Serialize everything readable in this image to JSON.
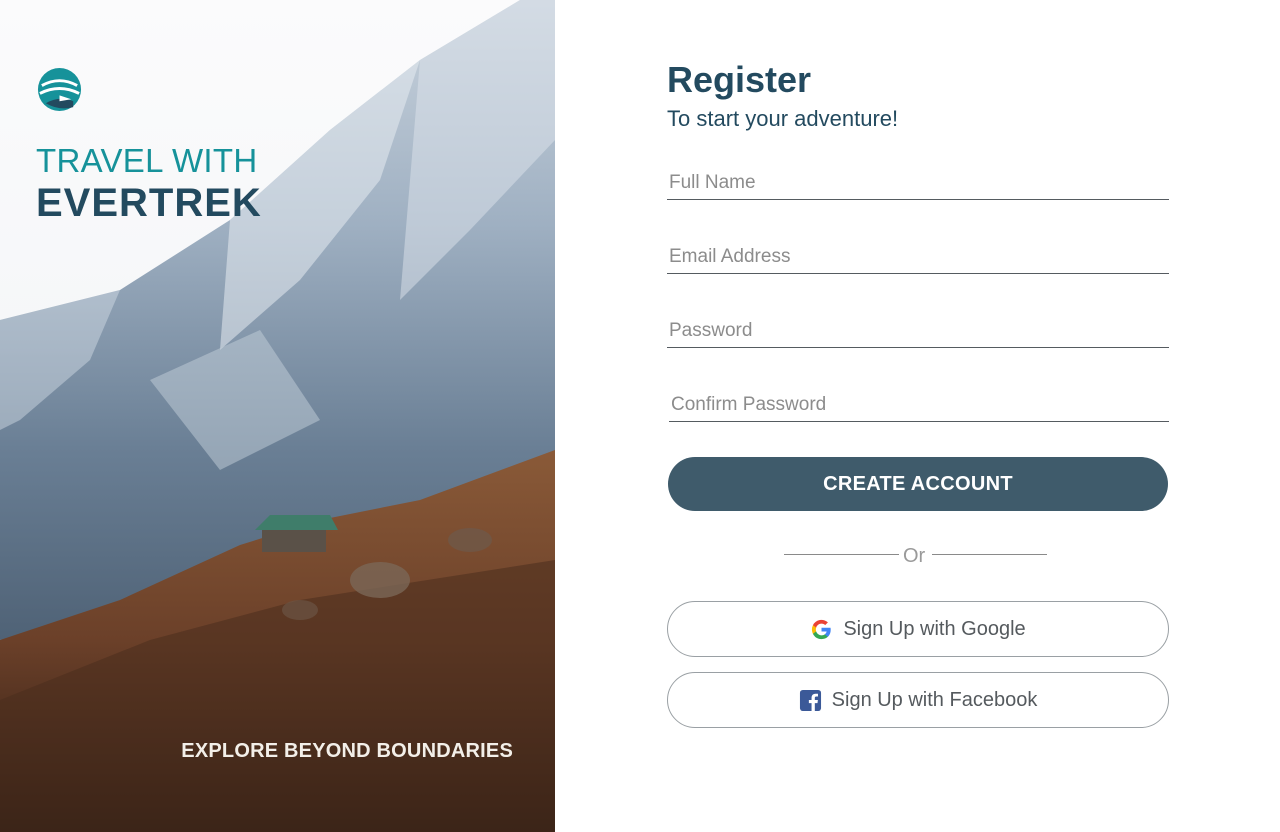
{
  "brand": {
    "line1": "TRAVEL WITH",
    "line2": "EVERTREK",
    "tagline": "EXPLORE BEYOND BOUNDARIES",
    "logo_icon": "globe-airplane-icon"
  },
  "form": {
    "title": "Register",
    "subtitle": "To start your adventure!",
    "fields": {
      "full_name": {
        "placeholder": "Full Name",
        "value": ""
      },
      "email": {
        "placeholder": "Email Address",
        "value": ""
      },
      "password": {
        "placeholder": "Password",
        "value": ""
      },
      "confirm_password": {
        "placeholder": "Confirm Password",
        "value": ""
      }
    },
    "create_label": "CREATE ACCOUNT",
    "divider_label": "Or",
    "google_label": "Sign Up with Google",
    "facebook_label": "Sign Up with Facebook"
  },
  "colors": {
    "brand_teal": "#16929a",
    "brand_navy": "#234a5f",
    "button_bg": "#3f5b6b"
  }
}
